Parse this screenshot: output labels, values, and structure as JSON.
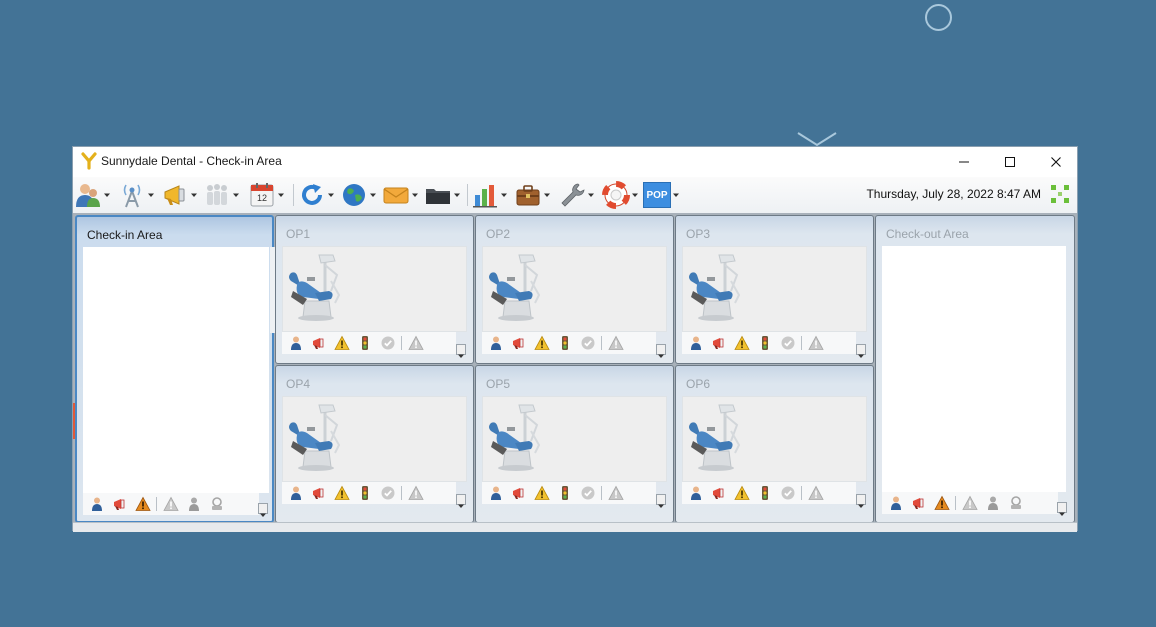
{
  "window": {
    "title": "Sunnydale Dental - Check-in Area"
  },
  "toolbar": {
    "datetime": "Thursday, July 28, 2022 8:47 AM",
    "calendar_day": "12",
    "pop_label": "POP",
    "icons": [
      "patients-icon",
      "broadcast-icon",
      "megaphone-icon",
      "staff-icon",
      "calendar-icon",
      "refresh-icon",
      "globe-icon",
      "mail-icon",
      "folder-icon",
      "chart-icon",
      "briefcase-icon",
      "wrench-icon",
      "lifebuoy-icon",
      "pop-icon"
    ]
  },
  "areas": {
    "checkin": {
      "label": "Check-in Area"
    },
    "checkout": {
      "label": "Check-out Area"
    }
  },
  "operatories": [
    {
      "label": "OP1"
    },
    {
      "label": "OP2"
    },
    {
      "label": "OP3"
    },
    {
      "label": "OP4"
    },
    {
      "label": "OP5"
    },
    {
      "label": "OP6"
    }
  ],
  "colors": {
    "desktop": "#437396",
    "panel_active_border": "#4a88c4",
    "warning": "#f2c12e",
    "accent_red": "#e05a3a"
  }
}
